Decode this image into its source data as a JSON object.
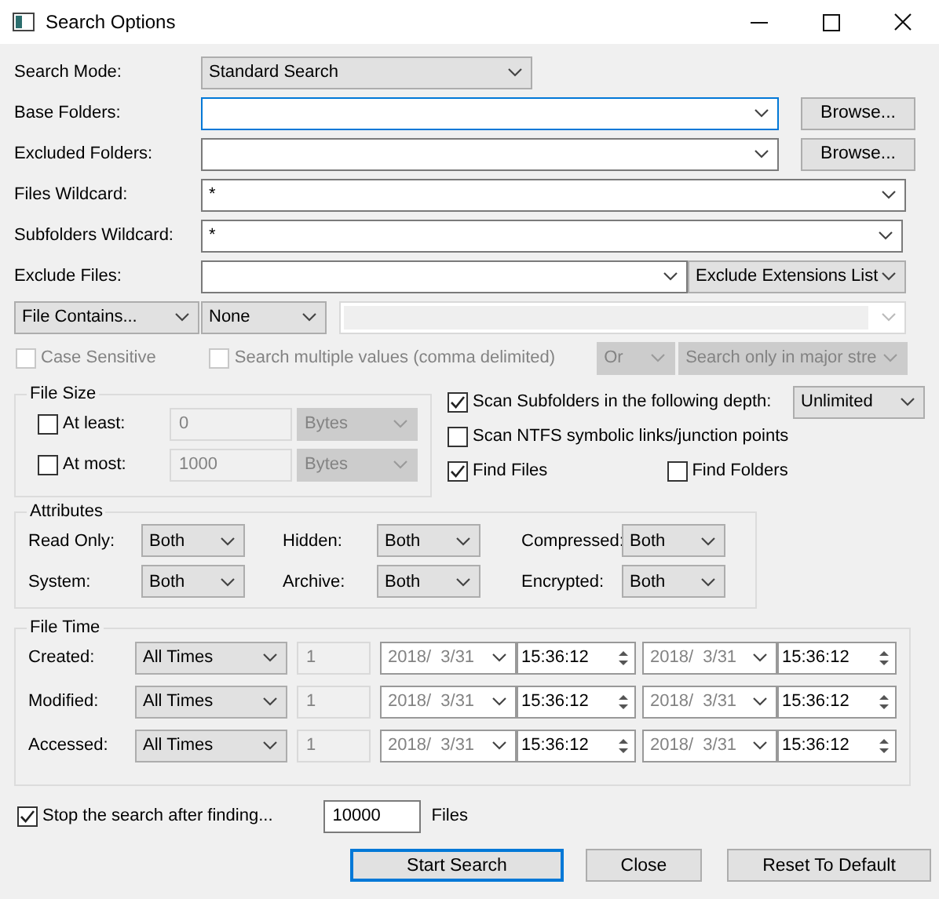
{
  "window": {
    "title": "Search Options"
  },
  "rows": [
    {
      "kind": "dropdown",
      "label": "Search Mode:",
      "value": "Standard Search"
    },
    {
      "kind": "browse",
      "label": "Base Folders:",
      "focused": true,
      "button": "Browse..."
    },
    {
      "kind": "browse",
      "label": "Excluded Folders:",
      "focused": false,
      "button": "Browse..."
    },
    {
      "kind": "combo",
      "label": "Files Wildcard:",
      "value": "*"
    },
    {
      "kind": "combo",
      "label": "Subfolders Wildcard:",
      "value": "*"
    },
    {
      "kind": "exclude",
      "label": "Exclude Files:",
      "option": "Exclude Extensions List"
    }
  ],
  "contains": {
    "mode": "File Contains...",
    "type": "None",
    "operator": "Or",
    "stream": "Search only in major stre",
    "checks": [
      {
        "label": "Case Sensitive",
        "checked": false,
        "disabled": true
      },
      {
        "label": "Search multiple values (comma delimited)",
        "checked": false,
        "disabled": true
      }
    ]
  },
  "file_size": {
    "title": "File Size",
    "rows": [
      {
        "label": "At least:",
        "checked": false,
        "value": "0",
        "unit": "Bytes",
        "disabled": true
      },
      {
        "label": "At most:",
        "checked": false,
        "value": "1000",
        "unit": "Bytes",
        "disabled": true
      }
    ]
  },
  "scan": {
    "label": "Scan Subfolders in the following depth:",
    "checked": true,
    "depth": "Unlimited"
  },
  "ntfs": {
    "label": "Scan NTFS symbolic links/junction points",
    "checked": false
  },
  "find": [
    {
      "label": "Find Files",
      "checked": true
    },
    {
      "label": "Find Folders",
      "checked": false
    }
  ],
  "attributes": {
    "title": "Attributes",
    "items": [
      {
        "label": "Read Only:",
        "value": "Both"
      },
      {
        "label": "Hidden:",
        "value": "Both"
      },
      {
        "label": "Compressed:",
        "value": "Both"
      },
      {
        "label": "System:",
        "value": "Both"
      },
      {
        "label": "Archive:",
        "value": "Both"
      },
      {
        "label": "Encrypted:",
        "value": "Both"
      }
    ]
  },
  "file_time": {
    "title": "File Time",
    "rows": [
      {
        "label": "Created:",
        "range": "All Times",
        "count": "1",
        "from_date": "2018/  3/31",
        "from_time": "15:36:12",
        "to_date": "2018/  3/31",
        "to_time": "15:36:12"
      },
      {
        "label": "Modified:",
        "range": "All Times",
        "count": "1",
        "from_date": "2018/  3/31",
        "from_time": "15:36:12",
        "to_date": "2018/  3/31",
        "to_time": "15:36:12"
      },
      {
        "label": "Accessed:",
        "range": "All Times",
        "count": "1",
        "from_date": "2018/  3/31",
        "from_time": "15:36:12",
        "to_date": "2018/  3/31",
        "to_time": "15:36:12"
      }
    ]
  },
  "stop": {
    "label": "Stop the search after finding...",
    "checked": true,
    "value": "10000",
    "unit": "Files"
  },
  "buttons": [
    {
      "label": "Start Search",
      "default": true
    },
    {
      "label": "Close",
      "default": false
    },
    {
      "label": "Reset To Default",
      "default": false
    }
  ]
}
